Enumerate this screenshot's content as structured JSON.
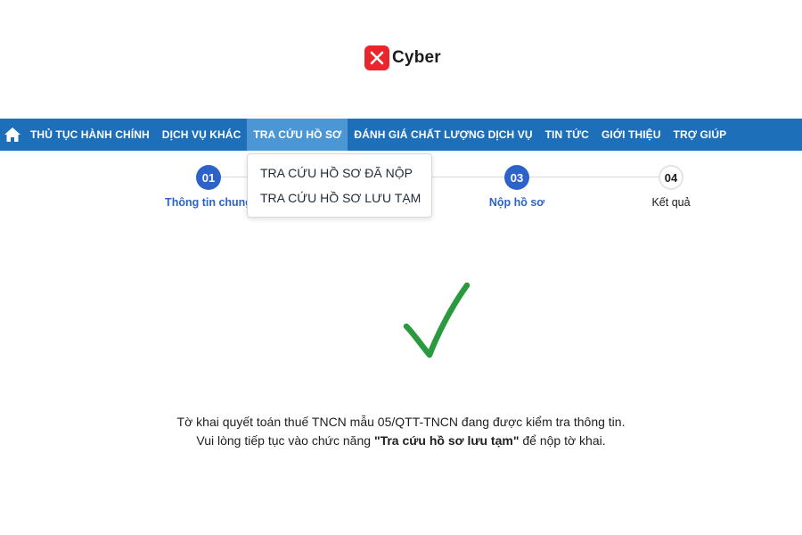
{
  "brand": {
    "name": "Cyber",
    "accent_color": "#e8262b",
    "icon": "x-mark-logo-icon"
  },
  "nav": {
    "home_icon": "home-icon",
    "items": [
      {
        "label": "THỦ TỤC HÀNH CHÍNH",
        "active": false
      },
      {
        "label": "DỊCH VỤ KHÁC",
        "active": false
      },
      {
        "label": "TRA CỨU HỒ SƠ",
        "active": true
      },
      {
        "label": "ĐÁNH GIÁ CHẤT LƯỢNG DỊCH VỤ",
        "active": false
      },
      {
        "label": "TIN TỨC",
        "active": false
      },
      {
        "label": "GIỚI THIỆU",
        "active": false
      },
      {
        "label": "TRỢ GIÚP",
        "active": false
      }
    ],
    "bar_color": "#1d6fba",
    "active_color": "#4b97d6"
  },
  "dropdown": {
    "items": [
      "TRA CỨU HỒ SƠ ĐÃ NỘP",
      "TRA CỨU HỒ SƠ LƯU TẠM"
    ]
  },
  "stepper": {
    "steps": [
      {
        "number": "01",
        "label": "Thông tin chung",
        "state": "done"
      },
      {
        "number": "03",
        "label": "Nộp hồ sơ",
        "state": "done"
      },
      {
        "number": "04",
        "label": "Kết quả",
        "state": "todo"
      }
    ],
    "done_color": "#2d63c8"
  },
  "result": {
    "icon": "checkmark-icon",
    "check_color": "#2a9a3e",
    "line1": "Tờ khai quyết toán thuế TNCN mẫu 05/QTT-TNCN đang được kiểm tra thông tin.",
    "line2_prefix": "Vui lòng tiếp tục vào chức năng ",
    "line2_bold": "\"Tra cứu hồ sơ lưu tạm\"",
    "line2_suffix": " để nộp tờ khai."
  }
}
